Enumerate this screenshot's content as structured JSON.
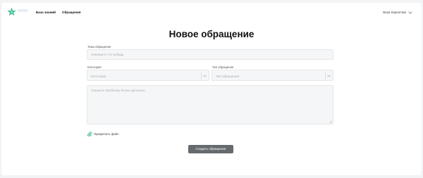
{
  "header": {
    "nav": [
      "База знаний",
      "Обращения"
    ],
    "user_name": "Вера Карпатова"
  },
  "page_title": "Новое обращение",
  "form": {
    "subject_label": "Тема обращения",
    "subject_placeholder": "Напишите что-нибудь",
    "category_label": "Категория",
    "category_placeholder": "Категория",
    "type_label": "Тип обращения",
    "type_placeholder": "Тип обращения",
    "description_placeholder": "Опишите проблему более детально",
    "attach_label": "Прикрепить файл",
    "submit_label": "Создать обращение"
  },
  "colors": {
    "logo_accent": "#2fb58a",
    "submit_button": "#666a6e",
    "background": "#f2f3f4"
  },
  "icons": {
    "logo": "star-logo-icon",
    "user_menu": "chevron-down-icon",
    "select": "chevron-down-icon",
    "attach": "paperclip-icon"
  }
}
